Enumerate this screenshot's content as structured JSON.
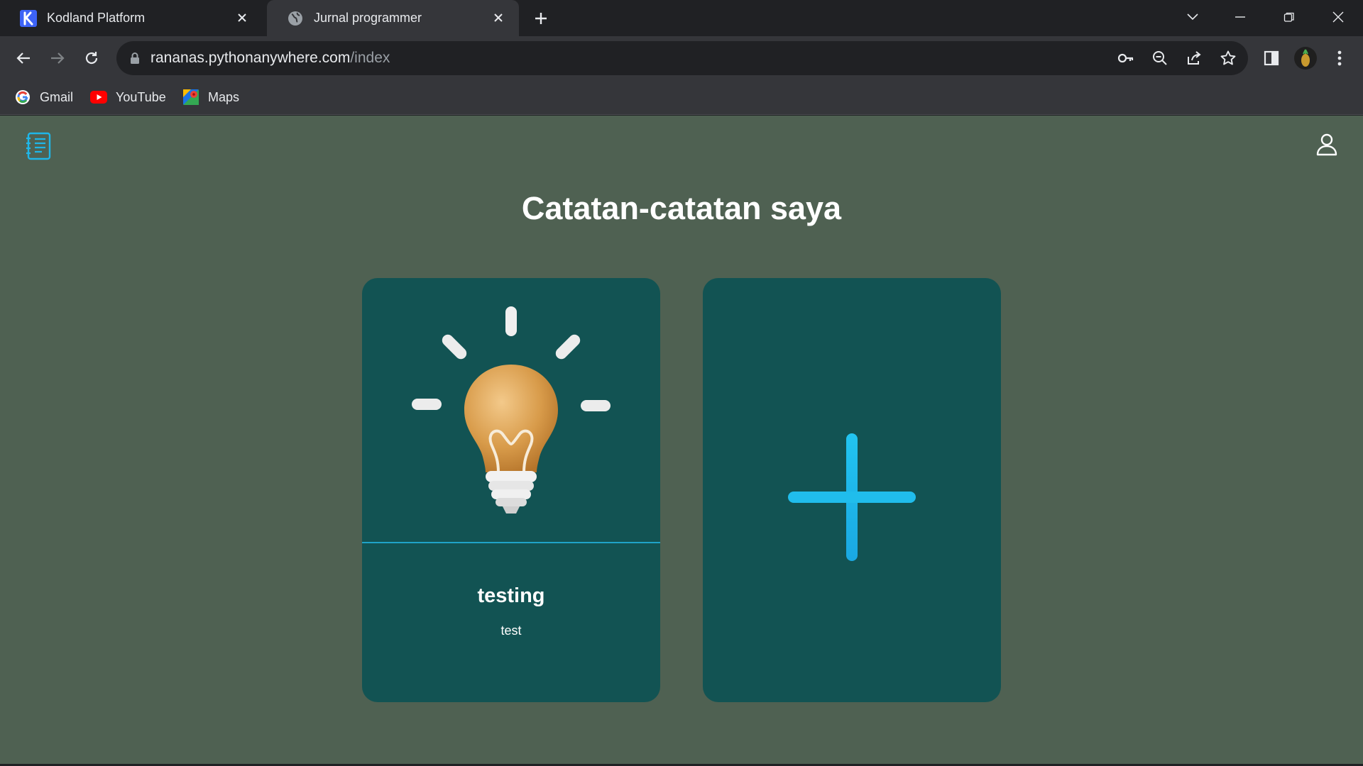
{
  "browser": {
    "tabs": [
      {
        "title": "Kodland Platform",
        "favicon": "kodland-k-icon",
        "active": false
      },
      {
        "title": "Jurnal programmer",
        "favicon": "globe-icon",
        "active": true
      }
    ],
    "address": {
      "domain": "rananas.pythonanywhere.com",
      "path": "/index"
    },
    "bookmarks": [
      {
        "label": "Gmail",
        "icon": "google-icon"
      },
      {
        "label": "YouTube",
        "icon": "youtube-icon"
      },
      {
        "label": "Maps",
        "icon": "maps-icon"
      }
    ]
  },
  "page": {
    "title": "Catatan-catatan saya",
    "notes": [
      {
        "title": "testing",
        "text": "test",
        "image": "lightbulb-icon"
      }
    ],
    "add_card_icon": "plus-icon"
  },
  "colors": {
    "page_background": "#4f6152",
    "card_background": "#125353",
    "accent": "#1fb6e8",
    "browser_dark": "#202124",
    "browser_toolbar": "#35363a"
  }
}
